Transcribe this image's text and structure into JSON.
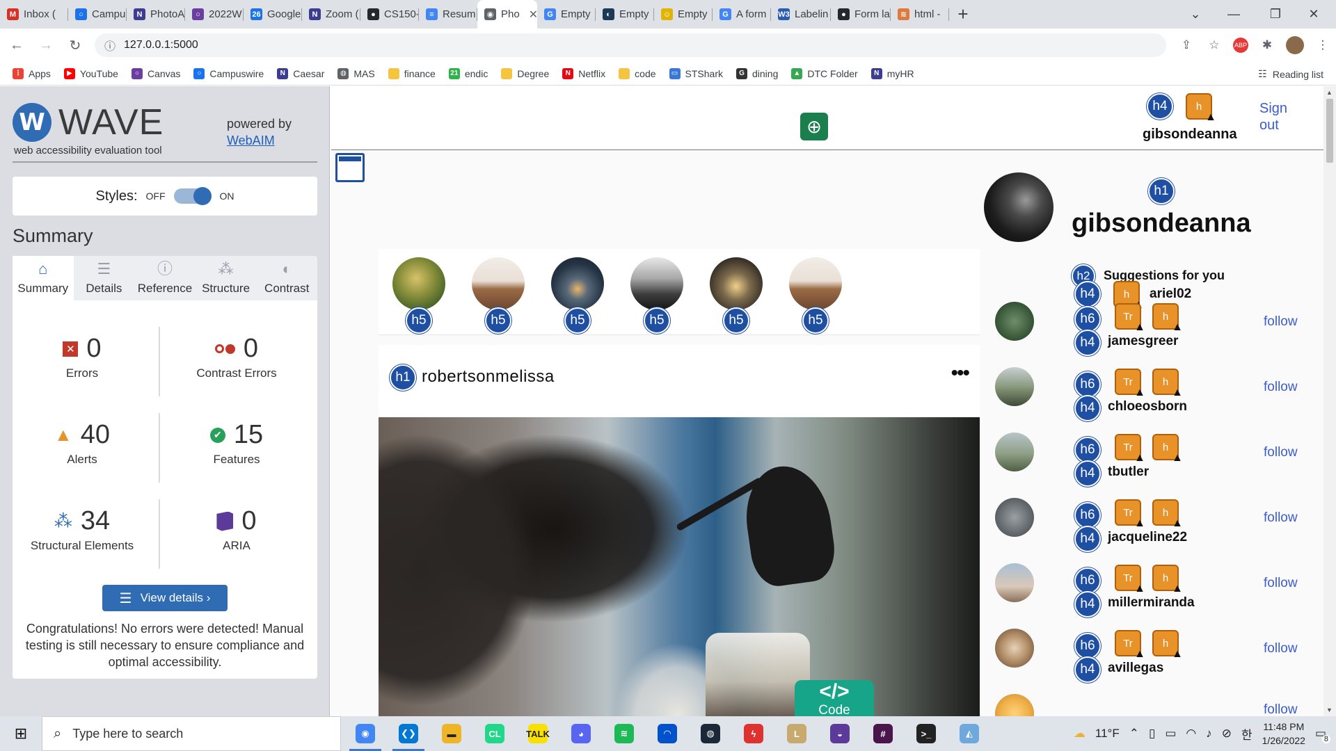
{
  "browser": {
    "tabs": [
      {
        "label": "Inbox (",
        "color": "#d93025",
        "glyph": "M"
      },
      {
        "label": "Campu",
        "color": "#1a73e8",
        "glyph": "○"
      },
      {
        "label": "PhotoA",
        "color": "#3d3d8f",
        "glyph": "N"
      },
      {
        "label": "2022W",
        "color": "#6b3fa0",
        "glyph": "○"
      },
      {
        "label": "Google",
        "color": "#1a73e8",
        "glyph": "26"
      },
      {
        "label": "Zoom (",
        "color": "#3d3d8f",
        "glyph": "N"
      },
      {
        "label": "CS150-",
        "color": "#24292e",
        "glyph": "●"
      },
      {
        "label": "Resum",
        "color": "#4285f4",
        "glyph": "≡"
      },
      {
        "label": "Pho",
        "color": "#5f6368",
        "glyph": "◉",
        "active": true
      },
      {
        "label": "Empty",
        "color": "#4285f4",
        "glyph": "G"
      },
      {
        "label": "Empty",
        "color": "#1b3a57",
        "glyph": "◐"
      },
      {
        "label": "Empty",
        "color": "#e0b400",
        "glyph": "☺"
      },
      {
        "label": "A form",
        "color": "#4285f4",
        "glyph": "G"
      },
      {
        "label": "Labelin",
        "color": "#2a5db0",
        "glyph": "W3"
      },
      {
        "label": "Form la",
        "color": "#24292e",
        "glyph": "●"
      },
      {
        "label": "html -",
        "color": "#e07a3c",
        "glyph": "≋"
      }
    ],
    "url": "127.0.0.1:5000",
    "bookmarks": [
      {
        "label": "Apps",
        "color": "#ea4335",
        "glyph": "⋮"
      },
      {
        "label": "YouTube",
        "color": "#ff0000",
        "glyph": "▶"
      },
      {
        "label": "Canvas",
        "color": "#6b3fa0",
        "glyph": "○"
      },
      {
        "label": "Campuswire",
        "color": "#1a73e8",
        "glyph": "○"
      },
      {
        "label": "Caesar",
        "color": "#3d3d8f",
        "glyph": "N"
      },
      {
        "label": "MAS",
        "color": "#5f6368",
        "glyph": "◍"
      },
      {
        "label": "finance",
        "color": "#f5c542",
        "glyph": ""
      },
      {
        "label": "endic",
        "color": "#2db34a",
        "glyph": "21"
      },
      {
        "label": "Degree",
        "color": "#f5c542",
        "glyph": ""
      },
      {
        "label": "Netflix",
        "color": "#e50914",
        "glyph": "N"
      },
      {
        "label": "code",
        "color": "#f5c542",
        "glyph": ""
      },
      {
        "label": "STShark",
        "color": "#3a78d6",
        "glyph": "▭"
      },
      {
        "label": "dining",
        "color": "#333333",
        "glyph": "G"
      },
      {
        "label": "DTC Folder",
        "color": "#34a853",
        "glyph": "▲"
      },
      {
        "label": "myHR",
        "color": "#3d3d8f",
        "glyph": "N"
      }
    ],
    "reading_list": "Reading list"
  },
  "wave": {
    "logo_letter": "W",
    "logo_word": "WAVE",
    "subtitle": "web accessibility evaluation tool",
    "powered_by": "powered by",
    "powered_link": "WebAIM",
    "styles_label": "Styles:",
    "styles_off": "OFF",
    "styles_on": "ON",
    "styles_state": "on",
    "summary_heading": "Summary",
    "tabs": [
      {
        "label": "Summary",
        "icon": "home-icon",
        "glyph": "⌂"
      },
      {
        "label": "Details",
        "icon": "list-icon",
        "glyph": "☰"
      },
      {
        "label": "Reference",
        "icon": "info-icon",
        "glyph": "ⓘ"
      },
      {
        "label": "Structure",
        "icon": "hierarchy-icon",
        "glyph": "⁂"
      },
      {
        "label": "Contrast",
        "icon": "contrast-icon",
        "glyph": "◐"
      }
    ],
    "stats": {
      "errors": {
        "value": "0",
        "label": "Errors",
        "icon": "error-icon",
        "glyph": "✕",
        "color": "#c0392b"
      },
      "contrast": {
        "value": "0",
        "label": "Contrast Errors",
        "icon": "contrast-error-icon",
        "glyph": "●●",
        "color": "#c0392b"
      },
      "alerts": {
        "value": "40",
        "label": "Alerts",
        "icon": "alert-icon",
        "glyph": "▲",
        "color": "#e8922a"
      },
      "features": {
        "value": "15",
        "label": "Features",
        "icon": "feature-check-icon",
        "glyph": "✔",
        "color": "#27a05a"
      },
      "structural": {
        "value": "34",
        "label": "Structural Elements",
        "icon": "structure-icon",
        "glyph": "⁂",
        "color": "#2f6cb3"
      },
      "aria": {
        "value": "0",
        "label": "ARIA",
        "icon": "aria-icon",
        "glyph": "◆",
        "color": "#5b3a9a"
      }
    },
    "view_details": "View details ›",
    "congrats": "Congratulations! No errors were detected! Manual testing is still necessary to ensure compliance and optimal accessibility."
  },
  "page": {
    "sign_out": "Sign out",
    "top_username": "gibsondeanna",
    "top_badges": [
      "h4",
      "h"
    ],
    "profile_h1": "h1",
    "profile_name": "gibsondeanna",
    "stories_badge": "h5",
    "story_count": 6,
    "post_badge": "h1",
    "post_username": "robertsonmelissa",
    "post_more": "•••",
    "suggestions_badge": "h2",
    "suggestions_title": "Suggestions for you",
    "first_suggestion": "ariel02",
    "first_suggestion_badges": [
      "h4",
      "h"
    ],
    "suggestions": [
      {
        "name": "jamesgreer",
        "follow": "follow"
      },
      {
        "name": "chloeosborn",
        "follow": "follow"
      },
      {
        "name": "tbutler",
        "follow": "follow"
      },
      {
        "name": "jacqueline22",
        "follow": "follow"
      },
      {
        "name": "millermiranda",
        "follow": "follow"
      },
      {
        "name": "avillegas",
        "follow": "follow"
      }
    ],
    "follow_label": "follow",
    "code_glyph": "</>",
    "code_label": "Code"
  },
  "taskbar": {
    "search_placeholder": "Type here to search",
    "weather": "11°F",
    "time": "11:48 PM",
    "date": "1/26/2022",
    "notification_count": "8",
    "apps": [
      {
        "name": "chrome-icon",
        "color": "#4285f4",
        "glyph": "◉",
        "running": true
      },
      {
        "name": "vscode-icon",
        "color": "#0078d4",
        "glyph": "❮❯",
        "running": true
      },
      {
        "name": "file-explorer-icon",
        "color": "#f0b429",
        "glyph": "▬",
        "running": false
      },
      {
        "name": "clion-icon",
        "color": "#21d789",
        "glyph": "CL",
        "running": false
      },
      {
        "name": "kakaotalk-icon",
        "color": "#f9e000",
        "glyph": "TALK",
        "running": false
      },
      {
        "name": "discord-icon",
        "color": "#5865f2",
        "glyph": "◕",
        "running": false
      },
      {
        "name": "spotify-icon",
        "color": "#1db954",
        "glyph": "≋",
        "running": false
      },
      {
        "name": "naver-icon",
        "color": "#0052cc",
        "glyph": "◠",
        "running": false
      },
      {
        "name": "steam-icon",
        "color": "#1b2838",
        "glyph": "◍",
        "running": false
      },
      {
        "name": "flash-icon",
        "color": "#e03131",
        "glyph": "ϟ",
        "running": false
      },
      {
        "name": "league-icon",
        "color": "#c8aa6e",
        "glyph": "L",
        "running": false
      },
      {
        "name": "eclipse-icon",
        "color": "#5b3a9a",
        "glyph": "◒",
        "running": false
      },
      {
        "name": "slack-icon",
        "color": "#4a154b",
        "glyph": "#",
        "running": false
      },
      {
        "name": "terminal-icon",
        "color": "#222222",
        "glyph": ">_",
        "running": false
      },
      {
        "name": "mysql-icon",
        "color": "#6fa8dc",
        "glyph": "◭",
        "running": false
      }
    ]
  }
}
